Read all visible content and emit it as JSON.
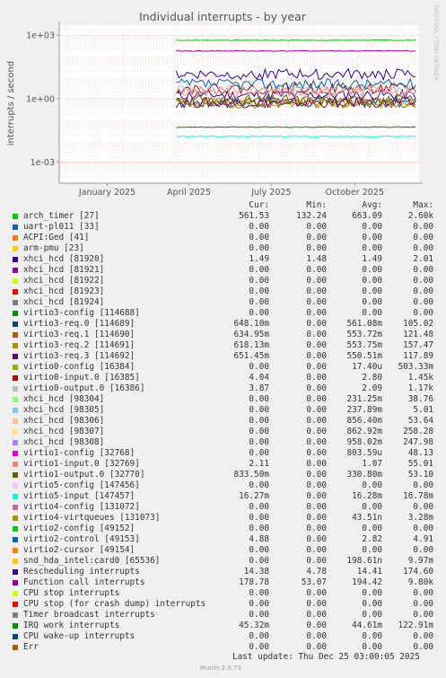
{
  "chart_data": {
    "type": "line",
    "title": "Individual interrupts - by year",
    "ylabel": "interrupts / second",
    "side_label": "RRDTOOL / TOBI OETIKER",
    "yscale": "log",
    "ylim": [
      0.0001,
      3000
    ],
    "y_ticks": [
      {
        "value": 1000,
        "label": "1e+03"
      },
      {
        "value": 1,
        "label": "1e+00"
      },
      {
        "value": 0.001,
        "label": "1e-03"
      }
    ],
    "x_range": [
      "2024-11-23",
      "2025-12-25"
    ],
    "x_ticks": [
      {
        "date": "2025-01-15",
        "label": "January 2025"
      },
      {
        "date": "2025-04-15",
        "label": "April 2025"
      },
      {
        "date": "2025-07-15",
        "label": "July 2025"
      },
      {
        "date": "2025-10-15",
        "label": "October 2025"
      }
    ],
    "grid": true,
    "data_start": "2025-04-01",
    "columns": [
      "Cur:",
      "Min:",
      "Avg:",
      "Max:"
    ],
    "series": [
      {
        "name": "arch_timer [27]",
        "color": "#00cc00",
        "cur": "561.53",
        "min": "132.24",
        "avg": "663.09",
        "max": "2.60k",
        "level": 580
      },
      {
        "name": "uart-pl011 [33]",
        "color": "#0066b3",
        "cur": "0.00",
        "min": "0.00",
        "avg": "0.00",
        "max": "0.00"
      },
      {
        "name": "ACPI:Ged [41]",
        "color": "#ff8000",
        "cur": "0.00",
        "min": "0.00",
        "avg": "0.00",
        "max": "0.00"
      },
      {
        "name": "arm-pmu [23]",
        "color": "#ffcc00",
        "cur": "0.00",
        "min": "0.00",
        "avg": "0.00",
        "max": "0.00"
      },
      {
        "name": "xhci_hcd [81920]",
        "color": "#330099",
        "cur": "1.49",
        "min": "1.48",
        "avg": "1.49",
        "max": "2.01",
        "level": 1.49
      },
      {
        "name": "xhci_hcd [81921]",
        "color": "#990099",
        "cur": "0.00",
        "min": "0.00",
        "avg": "0.00",
        "max": "0.00"
      },
      {
        "name": "xhci_hcd [81922]",
        "color": "#ccff00",
        "cur": "0.00",
        "min": "0.00",
        "avg": "0.00",
        "max": "0.00"
      },
      {
        "name": "xhci_hcd [81923]",
        "color": "#ff0000",
        "cur": "0.00",
        "min": "0.00",
        "avg": "0.00",
        "max": "0.00"
      },
      {
        "name": "xhci_hcd [81924]",
        "color": "#808080",
        "cur": "0.00",
        "min": "0.00",
        "avg": "0.00",
        "max": "0.00"
      },
      {
        "name": "virtio3-config [114688]",
        "color": "#008f00",
        "cur": "0.00",
        "min": "0.00",
        "avg": "0.00",
        "max": "0.00"
      },
      {
        "name": "virtio3-req.0 [114689]",
        "color": "#00487d",
        "cur": "648.10m",
        "min": "0.00",
        "avg": "561.08m",
        "max": "105.02",
        "level": 0.65
      },
      {
        "name": "virtio3-req.1 [114690]",
        "color": "#b35a00",
        "cur": "634.95m",
        "min": "0.00",
        "avg": "553.72m",
        "max": "121.48",
        "level": 0.63
      },
      {
        "name": "virtio3-req.2 [114691]",
        "color": "#b38f00",
        "cur": "618.13m",
        "min": "0.00",
        "avg": "553.75m",
        "max": "157.47",
        "level": 0.62
      },
      {
        "name": "virtio3-req.3 [114692]",
        "color": "#6b006b",
        "cur": "651.45m",
        "min": "0.00",
        "avg": "550.51m",
        "max": "117.89",
        "level": 0.65
      },
      {
        "name": "virtio0-config [16384]",
        "color": "#8fb300",
        "cur": "0.00",
        "min": "0.00",
        "avg": "17.40u",
        "max": "503.33m"
      },
      {
        "name": "virtio0-input.0 [16385]",
        "color": "#b30000",
        "cur": "4.04",
        "min": "0.00",
        "avg": "2.80",
        "max": "1.45k",
        "level": 3
      },
      {
        "name": "virtio0-output.0 [16386]",
        "color": "#bebebe",
        "cur": "3.87",
        "min": "0.00",
        "avg": "2.09",
        "max": "1.17k",
        "level": 2.5
      },
      {
        "name": "xhci_hcd [98304]",
        "color": "#80ff80",
        "cur": "0.00",
        "min": "0.00",
        "avg": "231.25m",
        "max": "38.76"
      },
      {
        "name": "xhci_hcd [98305]",
        "color": "#80c9ff",
        "cur": "0.00",
        "min": "0.00",
        "avg": "237.89m",
        "max": "5.01"
      },
      {
        "name": "xhci_hcd [98306]",
        "color": "#ffc080",
        "cur": "0.00",
        "min": "0.00",
        "avg": "856.40m",
        "max": "53.64"
      },
      {
        "name": "xhci_hcd [98307]",
        "color": "#ffe680",
        "cur": "0.00",
        "min": "0.00",
        "avg": "862.92m",
        "max": "258.28"
      },
      {
        "name": "xhci_hcd [98308]",
        "color": "#aa80ff",
        "cur": "0.00",
        "min": "0.00",
        "avg": "958.02m",
        "max": "247.98"
      },
      {
        "name": "virtio1-config [32768]",
        "color": "#ee00cc",
        "cur": "0.00",
        "min": "0.00",
        "avg": "803.59u",
        "max": "48.13"
      },
      {
        "name": "virtio1-input.0 [32769]",
        "color": "#ff8080",
        "cur": "2.11",
        "min": "0.00",
        "avg": "1.07",
        "max": "55.01",
        "level": 2.1
      },
      {
        "name": "virtio1-output.0 [32770]",
        "color": "#666600",
        "cur": "833.50m",
        "min": "0.00",
        "avg": "330.80m",
        "max": "53.10",
        "level": 0.83
      },
      {
        "name": "virtio5-config [147456]",
        "color": "#ffbfff",
        "cur": "0.00",
        "min": "0.00",
        "avg": "0.00",
        "max": "0.00"
      },
      {
        "name": "virtio5-input [147457]",
        "color": "#00ffcc",
        "cur": "16.27m",
        "min": "0.00",
        "avg": "16.28m",
        "max": "16.78m",
        "level": 0.0163
      },
      {
        "name": "virtio4-config [131072]",
        "color": "#cc6699",
        "cur": "0.00",
        "min": "0.00",
        "avg": "0.00",
        "max": "0.00"
      },
      {
        "name": "virtio4-virtqueues [131073]",
        "color": "#999900",
        "cur": "0.00",
        "min": "0.00",
        "avg": "43.51n",
        "max": "3.28m"
      },
      {
        "name": "virtio2-config [49152]",
        "color": "#00cc00",
        "cur": "0.00",
        "min": "0.00",
        "avg": "0.00",
        "max": "0.00"
      },
      {
        "name": "virtio2-control [49153]",
        "color": "#0066b3",
        "cur": "4.88",
        "min": "0.00",
        "avg": "2.82",
        "max": "4.91",
        "level": 4.88
      },
      {
        "name": "virtio2-cursor [49154]",
        "color": "#ff8000",
        "cur": "0.00",
        "min": "0.00",
        "avg": "0.00",
        "max": "0.00"
      },
      {
        "name": "snd_hda_intel:card0 [65536]",
        "color": "#ffcc00",
        "cur": "0.00",
        "min": "0.00",
        "avg": "198.61n",
        "max": "9.97m"
      },
      {
        "name": "Rescheduling interrupts",
        "color": "#330099",
        "cur": "14.38",
        "min": "4.78",
        "avg": "14.41",
        "max": "174.60",
        "level": 14.4
      },
      {
        "name": "Function call interrupts",
        "color": "#990099",
        "cur": "178.78",
        "min": "53.07",
        "avg": "194.42",
        "max": "9.80k",
        "level": 180
      },
      {
        "name": "CPU stop interrupts",
        "color": "#ccff00",
        "cur": "0.00",
        "min": "0.00",
        "avg": "0.00",
        "max": "0.00"
      },
      {
        "name": "CPU stop (for crash dump) interrupts",
        "color": "#ff0000",
        "cur": "0.00",
        "min": "0.00",
        "avg": "0.00",
        "max": "0.00"
      },
      {
        "name": "Timer broadcast interrupts",
        "color": "#808080",
        "cur": "0.00",
        "min": "0.00",
        "avg": "0.00",
        "max": "0.00"
      },
      {
        "name": "IRQ work interrupts",
        "color": "#008f00",
        "cur": "45.32m",
        "min": "0.00",
        "avg": "44.61m",
        "max": "122.91m",
        "level": 0.045
      },
      {
        "name": "CPU wake-up interrupts",
        "color": "#00487d",
        "cur": "0.00",
        "min": "0.00",
        "avg": "0.00",
        "max": "0.00"
      },
      {
        "name": "Err",
        "color": "#b35a00",
        "cur": "0.00",
        "min": "0.00",
        "avg": "0.00",
        "max": "0.00"
      }
    ]
  },
  "footer": {
    "last_update": "Last update: Thu Dec 25 03:00:05 2025",
    "munin": "Munin 2.0.73"
  }
}
